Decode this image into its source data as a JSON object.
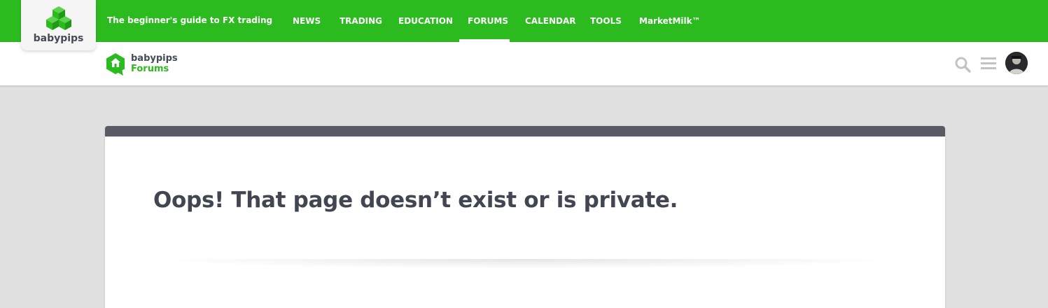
{
  "header": {
    "brand": "babypips",
    "tagline": "The beginner's guide to FX trading",
    "nav": [
      {
        "label": "NEWS"
      },
      {
        "label": "TRADING"
      },
      {
        "label": "EDUCATION"
      },
      {
        "label": "FORUMS",
        "active": true
      },
      {
        "label": "CALENDAR"
      },
      {
        "label": "TOOLS"
      },
      {
        "label": "MarketMilk™"
      }
    ]
  },
  "subheader": {
    "logo_line1": "babypips",
    "logo_line2": "Forums",
    "icons": [
      "search-icon",
      "menu-icon",
      "avatar"
    ]
  },
  "main": {
    "title": "Oops! That page doesn’t exist or is private."
  },
  "colors": {
    "brand_green": "#2bbb1f",
    "card_header": "#585a64",
    "text_dark": "#414652",
    "background": "#e1e1e1"
  }
}
